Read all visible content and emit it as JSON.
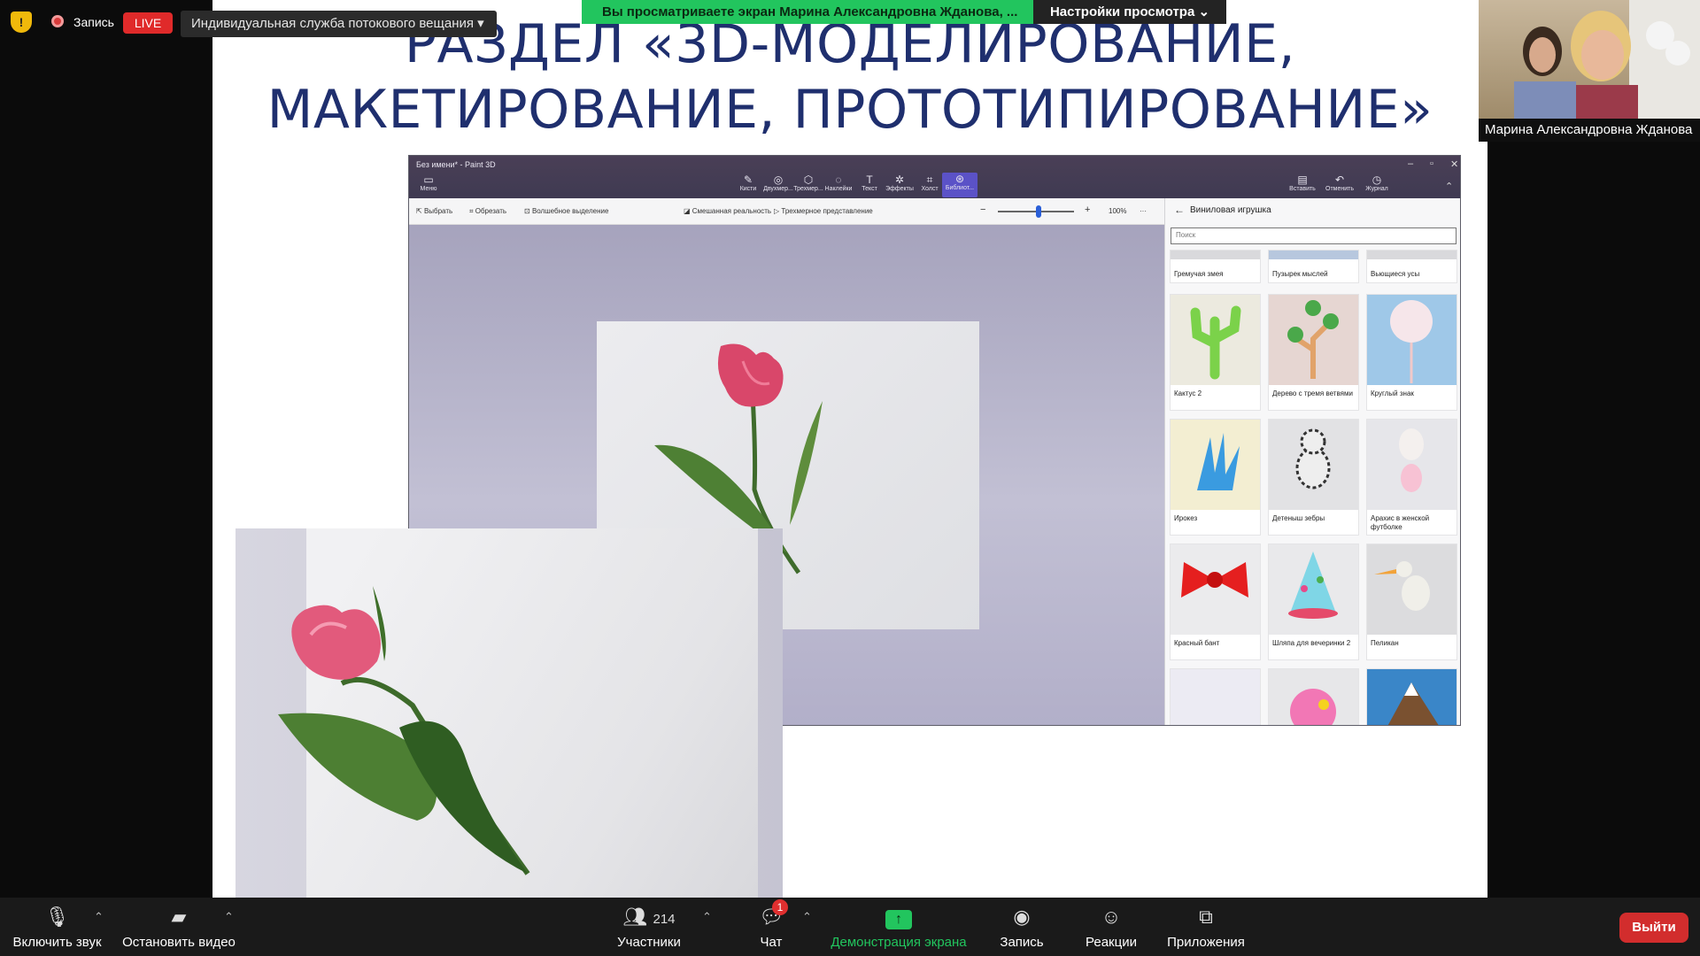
{
  "zoom": {
    "recording_label": "Запись",
    "live_label": "LIVE",
    "stream_label": "Индивидуальная служба потокового вещания",
    "viewing_banner": "Вы просматриваете экран Марина Александровна Жданова, ...",
    "view_options": "Настройки просмотра",
    "participant_name": "Марина Александровна Жданова",
    "bottom": {
      "unmute": "Включить звук",
      "stop_video": "Остановить видео",
      "participants_count": "214",
      "participants": "Участники",
      "chat": "Чат",
      "chat_badge": "1",
      "share": "Демонстрация экрана",
      "record": "Запись",
      "reactions": "Реакции",
      "apps": "Приложения",
      "leave": "Выйти"
    },
    "colors": {
      "share_green": "#22c55e",
      "live_red": "#e02a2a",
      "leave_red": "#d22d2d"
    }
  },
  "slide": {
    "title_line1": "РАЗДЕЛ «3D-МОДЕЛИРОВАНИЕ,",
    "title_line2": "МАКЕТИРОВАНИЕ, ПРОТОТИПИРОВАНИЕ»",
    "title_color": "#1f2f6e"
  },
  "paint3d": {
    "window_title": "Без имени* - Paint 3D",
    "menu": "Меню",
    "tools": [
      "Кисти",
      "Двухмер...",
      "Трехмер...",
      "Наклейки",
      "Текст",
      "Эффекты",
      "Холст",
      "Библиот..."
    ],
    "right_tools": [
      "Вставить",
      "Отменить",
      "Журнал"
    ],
    "sub": {
      "select": "Выбрать",
      "crop": "Обрезать",
      "magic_select": "Волшебное выделение",
      "mixed_reality": "Смешанная реальность",
      "view_3d": "Трехмерное представление",
      "zoom": "100%"
    },
    "panel": {
      "title": "Виниловая игрушка",
      "search_placeholder": "Поиск",
      "items": [
        "Гремучая змея",
        "Пузырек мыслей",
        "Вьющиеся усы",
        "Кактус 2",
        "Дерево с тремя ветвями",
        "Круглый знак",
        "Ирокез",
        "Детеныш зебры",
        "Арахис в женской футболке",
        "Красный бант",
        "Шляпа для вечеринки 2",
        "Пеликан"
      ]
    }
  }
}
